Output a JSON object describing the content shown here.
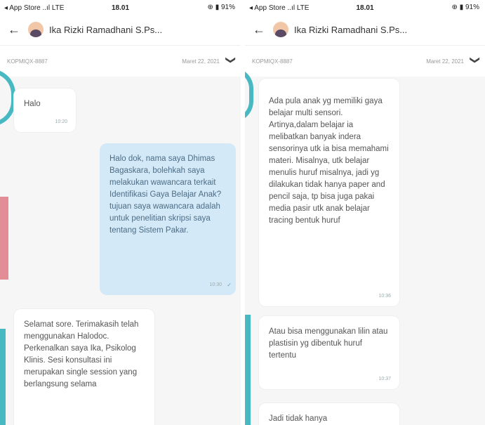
{
  "panels": [
    {
      "status": {
        "carrier": "◂ App Store ..ıl LTE",
        "time": "18.01",
        "right": "⊕ ▮ 91%"
      },
      "header": {
        "name": "Ika Rizki Ramadhani S.Ps..."
      },
      "subbar": {
        "code": "KOPMIQX-8887",
        "date": "Maret 22, 2021"
      },
      "messages": [
        {
          "text": "Halo",
          "time": "10:20"
        },
        {
          "text": "Halo dok, nama saya Dhimas Bagaskara, bolehkah saya melakukan wawancara terkait Identifikasi Gaya Belajar Anak? tujuan saya wawancara adalah untuk penelitian skripsi saya tentang Sistem Pakar.",
          "time": "10:30"
        },
        {
          "text": "Selamat sore. Terimakasih telah menggunakan Halodoc. Perkenalkan saya Ika, Psikolog Klinis. Sesi konsultasi ini merupakan single session yang berlangsung selama"
        }
      ]
    },
    {
      "status": {
        "carrier": "◂ App Store ..ıl LTE",
        "time": "18.01",
        "right": "⊕ ▮ 91%"
      },
      "header": {
        "name": "Ika Rizki Ramadhani S.Ps..."
      },
      "subbar": {
        "code": "KOPMIQX-8887",
        "date": "Maret 22, 2021"
      },
      "messages": [
        {
          "text": "Ada pula anak yg memiliki gaya belajar multi sensori. Artinya,dalam belajar ia melibatkan banyak indera sensorinya utk ia bisa memahami materi. Misalnya, utk belajar menulis huruf misalnya, jadi yg dilakukan tidak hanya paper and pencil saja, tp bisa juga pakai media pasir utk anak belajar tracing bentuk huruf",
          "time": "10:36"
        },
        {
          "text": "Atau bisa menggunakan lilin atau plastisin yg dibentuk huruf tertentu",
          "time": "10:37"
        },
        {
          "text": "Jadi tidak hanya"
        }
      ]
    }
  ],
  "colors": {
    "outgoing_bubble": "#d4e9f7",
    "incoming_bubble": "#ffffff",
    "background": "#f6f6f6",
    "accent_teal": "#48b9c2",
    "accent_pink": "#e38d97"
  },
  "icons": {
    "back": "back-arrow-icon",
    "chevron": "chevron-down-icon",
    "battery": "battery-icon",
    "check": "double-check-icon"
  }
}
